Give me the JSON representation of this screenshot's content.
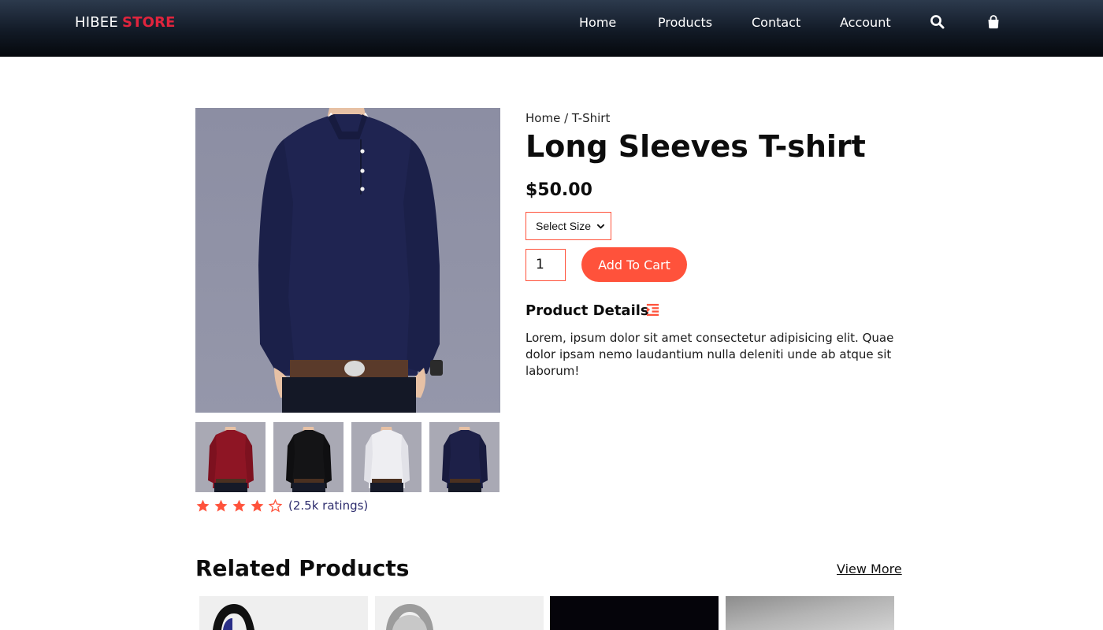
{
  "nav": {
    "brand_prefix": "HIBEE",
    "brand_accent": "STORE",
    "links": [
      "Home",
      "Products",
      "Contact",
      "Account"
    ],
    "icons": [
      "search-icon",
      "shopping-bag-icon"
    ]
  },
  "product": {
    "breadcrumb": "Home / T-Shirt",
    "title": "Long Sleeves T-shirt",
    "price": "$50.00",
    "size_select": {
      "selected": "Select Size"
    },
    "quantity": "1",
    "add_to_cart": "Add To Cart",
    "details_heading": "Product Details",
    "details_icon": "indent-icon",
    "description": "Lorem, ipsum dolor sit amet consectetur adipisicing elit. Quae dolor ipsam nemo laudantium nulla deleniti unde ab atque sit laborum!",
    "rating": {
      "stars": 4,
      "max": 5,
      "text": "(2.5k ratings)"
    },
    "thumbnails": [
      {
        "shirt_color": "#8e1524"
      },
      {
        "shirt_color": "#141416"
      },
      {
        "shirt_color": "#eeeef2"
      },
      {
        "shirt_color": "#1d2048"
      }
    ]
  },
  "related": {
    "heading": "Related Products",
    "view_more": "View More",
    "cards": 4
  },
  "colors": {
    "accent": "#ff523b",
    "brand_accent": "#e0243d",
    "rating_text": "#2e2d6e"
  }
}
